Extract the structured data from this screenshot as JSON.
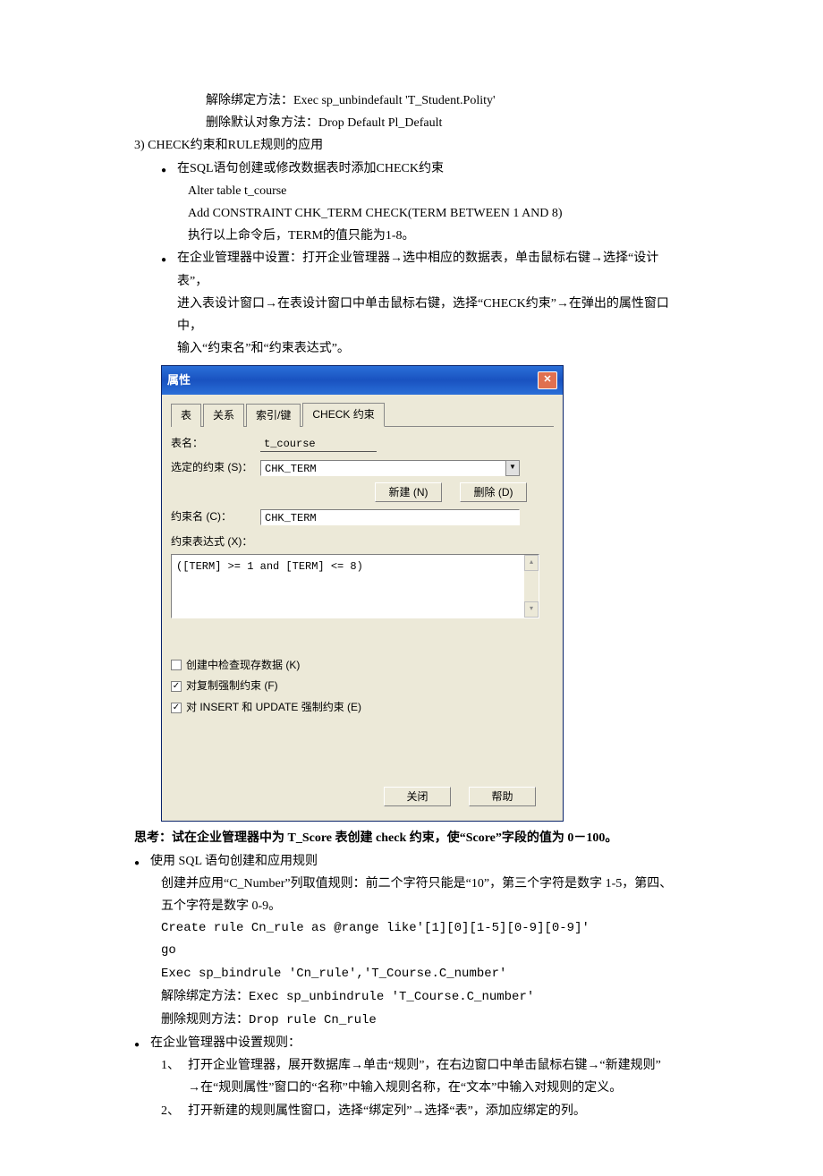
{
  "text": {
    "unbind_default": "解除绑定方法：Exec sp_unbindefault 'T_Student.Polity'",
    "drop_default": "删除默认对象方法：Drop Default Pl_Default",
    "section3": "3) CHECK约束和RULE规则的应用",
    "b1": "在SQL语句创建或修改数据表时添加CHECK约束",
    "alter1": "Alter    table t_course",
    "alter2": "Add CONSTRAINT CHK_TERM CHECK(TERM    BETWEEN    1    AND    8)",
    "alter3": "执行以上命令后，TERM的值只能为1-8。",
    "b2a": "在企业管理器中设置：打开企业管理器→选中相应的数据表，单击鼠标右键→选择“设计表”，",
    "b2b": "进入表设计窗口→在表设计窗口中单击鼠标右键，选择“CHECK约束”→在弹出的属性窗口中，",
    "b2c": "输入“约束名”和“约束表达式”。",
    "think": "思考：试在企业管理器中为 T_Score 表创建 check 约束，使“Score”字段的值为 0－100。",
    "b3": "使用 SQL 语句创建和应用规则",
    "rule_desc1": "创建并应用“C_Number”列取值规则：前二个字符只能是“10”，第三个字符是数字 1-5，第四、",
    "rule_desc2": "五个字符是数字 0-9。",
    "create_rule": "Create rule Cn_rule as @range like'[1][0][1-5][0-9][0-9]'",
    "go": "go",
    "bind_rule": "Exec sp_bindrule 'Cn_rule','T_Course.C_number'",
    "unbind_rule": "解除绑定方法：Exec sp_unbindrule   'T_Course.C_number'",
    "drop_rule": "删除规则方法：Drop rule Cn_rule",
    "b4": "在企业管理器中设置规则：",
    "n1a": "打开企业管理器，展开数据库→单击“规则”，在右边窗口中单击鼠标右键→“新建规则”",
    "n1b": "→在“规则属性”窗口的“名称”中输入规则名称，在“文本”中输入对规则的定义。",
    "n2": "打开新建的规则属性窗口，选择“绑定列”→选择“表”，添加应绑定的列。"
  },
  "dialog": {
    "title": "属性",
    "tabs": [
      "表",
      "关系",
      "索引/键",
      "CHECK 约束"
    ],
    "table_label": "表名：",
    "table_value": "t_course",
    "selected_label": "选定的约束 (S)：",
    "selected_value": "CHK_TERM",
    "btn_new": "新建 (N)",
    "btn_del": "删除 (D)",
    "name_label": "约束名 (C)：",
    "name_value": "CHK_TERM",
    "expr_label": "约束表达式 (X)：",
    "expr_value": "([TERM] >= 1 and [TERM] <= 8)",
    "chk1": "创建中检查现存数据 (K)",
    "chk2": "对复制强制约束 (F)",
    "chk3": "对 INSERT 和 UPDATE 强制约束 (E)",
    "btn_close": "关闭",
    "btn_help": "帮助"
  }
}
